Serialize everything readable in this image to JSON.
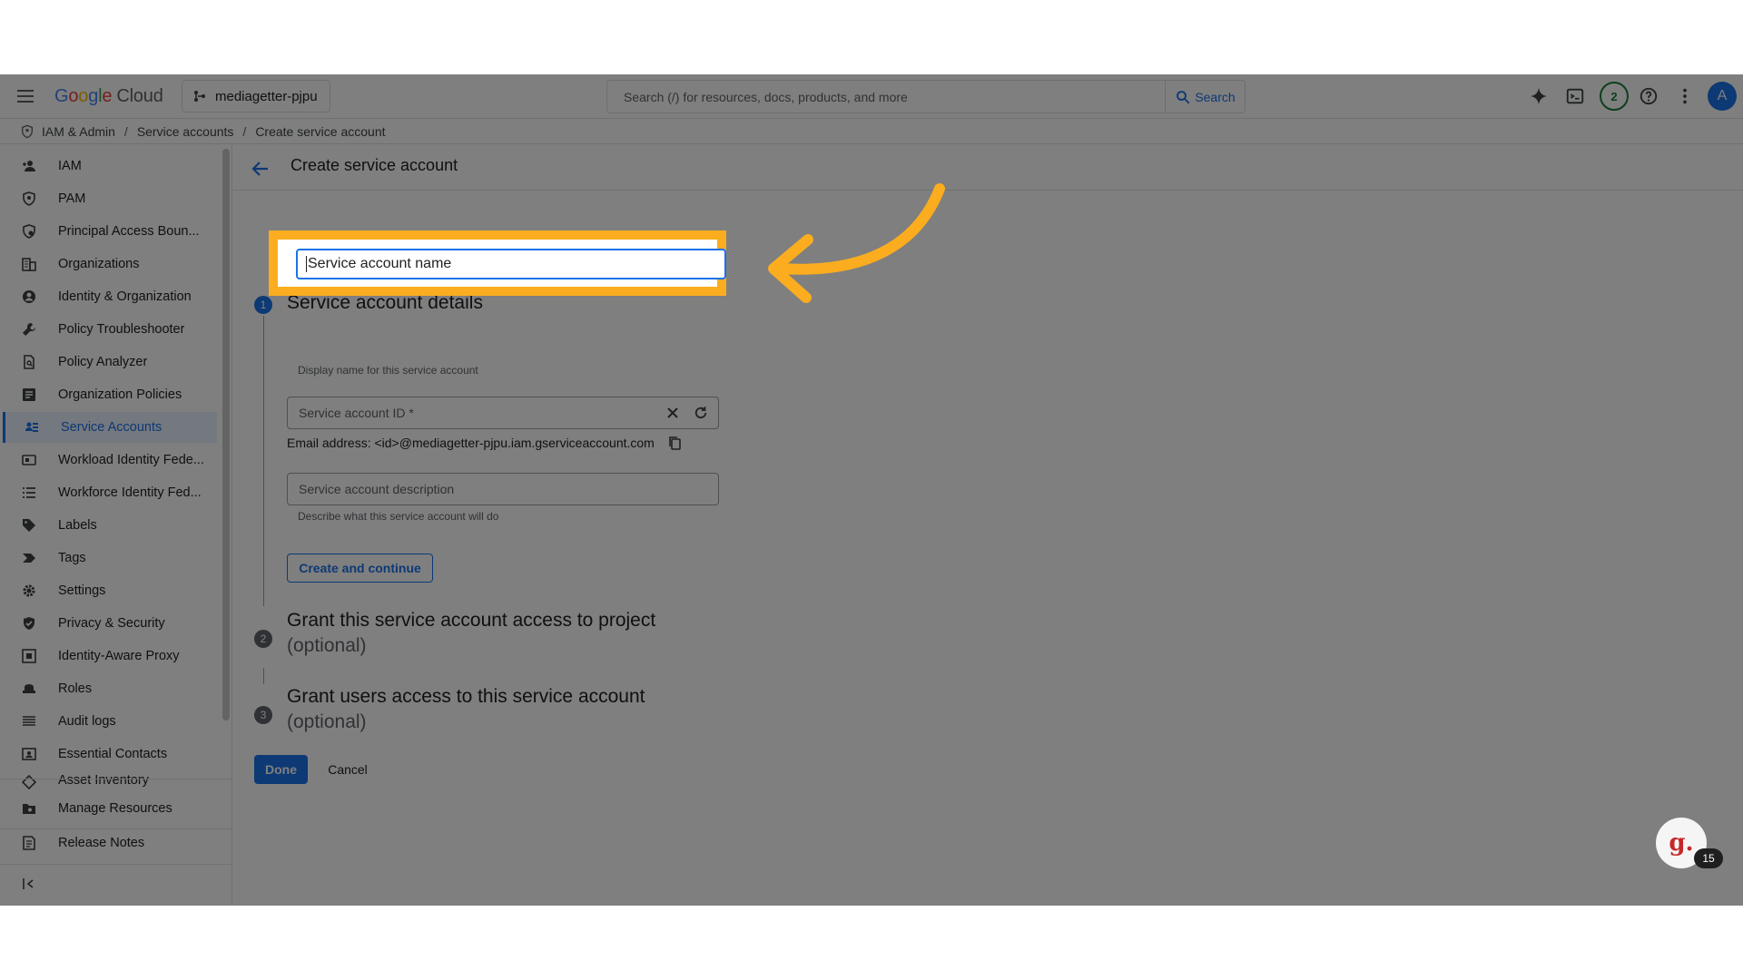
{
  "topbar": {
    "logo_letters": [
      "G",
      "o",
      "o",
      "g",
      "l",
      "e"
    ],
    "logo_suffix": "Cloud",
    "project": "mediagetter-pjpu",
    "search_placeholder": "Search (/) for resources, docs, products, and more",
    "search_button": "Search",
    "notification_count": "2",
    "avatar_letter": "A"
  },
  "breadcrumb": {
    "items": [
      "IAM & Admin",
      "Service accounts",
      "Create service account"
    ],
    "separator": "/"
  },
  "sidebar": {
    "items": [
      {
        "label": "IAM",
        "icon": "person-add-icon"
      },
      {
        "label": "PAM",
        "icon": "shield-icon"
      },
      {
        "label": "Principal Access Boun...",
        "icon": "policy-icon"
      },
      {
        "label": "Organizations",
        "icon": "building-icon"
      },
      {
        "label": "Identity & Organization",
        "icon": "account-circle-icon"
      },
      {
        "label": "Policy Troubleshooter",
        "icon": "wrench-icon"
      },
      {
        "label": "Policy Analyzer",
        "icon": "document-search-icon"
      },
      {
        "label": "Organization Policies",
        "icon": "list-box-icon"
      },
      {
        "label": "Service Accounts",
        "icon": "service-account-icon",
        "active": true
      },
      {
        "label": "Workload Identity Fede...",
        "icon": "badge-icon"
      },
      {
        "label": "Workforce Identity Fed...",
        "icon": "list-icon"
      },
      {
        "label": "Labels",
        "icon": "tag-icon"
      },
      {
        "label": "Tags",
        "icon": "label-arrow-icon"
      },
      {
        "label": "Settings",
        "icon": "gear-icon"
      },
      {
        "label": "Privacy & Security",
        "icon": "shield-check-icon"
      },
      {
        "label": "Identity-Aware Proxy",
        "icon": "proxy-icon"
      },
      {
        "label": "Roles",
        "icon": "hat-icon"
      },
      {
        "label": "Audit logs",
        "icon": "lines-icon"
      },
      {
        "label": "Essential Contacts",
        "icon": "contacts-icon"
      },
      {
        "label": "Asset Inventory",
        "icon": "diamond-icon"
      }
    ],
    "bottom_items": [
      {
        "label": "Manage Resources",
        "icon": "folder-gear-icon"
      },
      {
        "label": "Release Notes",
        "icon": "notes-icon"
      }
    ],
    "collapse_icon": "collapse-left-icon"
  },
  "page": {
    "title": "Create service account",
    "step1": {
      "number": "1",
      "title": "Service account details",
      "name_field_value": "Service account name",
      "name_hint": "Display name for this service account",
      "id_placeholder": "Service account ID *",
      "email_text": "Email address: <id>@mediagetter-pjpu.iam.gserviceaccount.com",
      "description_placeholder": "Service account description",
      "description_hint": "Describe what this service account will do",
      "create_button": "Create and continue"
    },
    "step2": {
      "number": "2",
      "title": "Grant this service account access to project",
      "optional": "(optional)"
    },
    "step3": {
      "number": "3",
      "title": "Grant users access to this service account",
      "optional": "(optional)"
    },
    "done_button": "Done",
    "cancel_button": "Cancel"
  },
  "guide": {
    "logo_letter": "g.",
    "count": "15"
  },
  "colors": {
    "accent": "#1a73e8",
    "highlight": "#fbad1f",
    "overlay": "rgba(0,0,0,0.5)"
  }
}
